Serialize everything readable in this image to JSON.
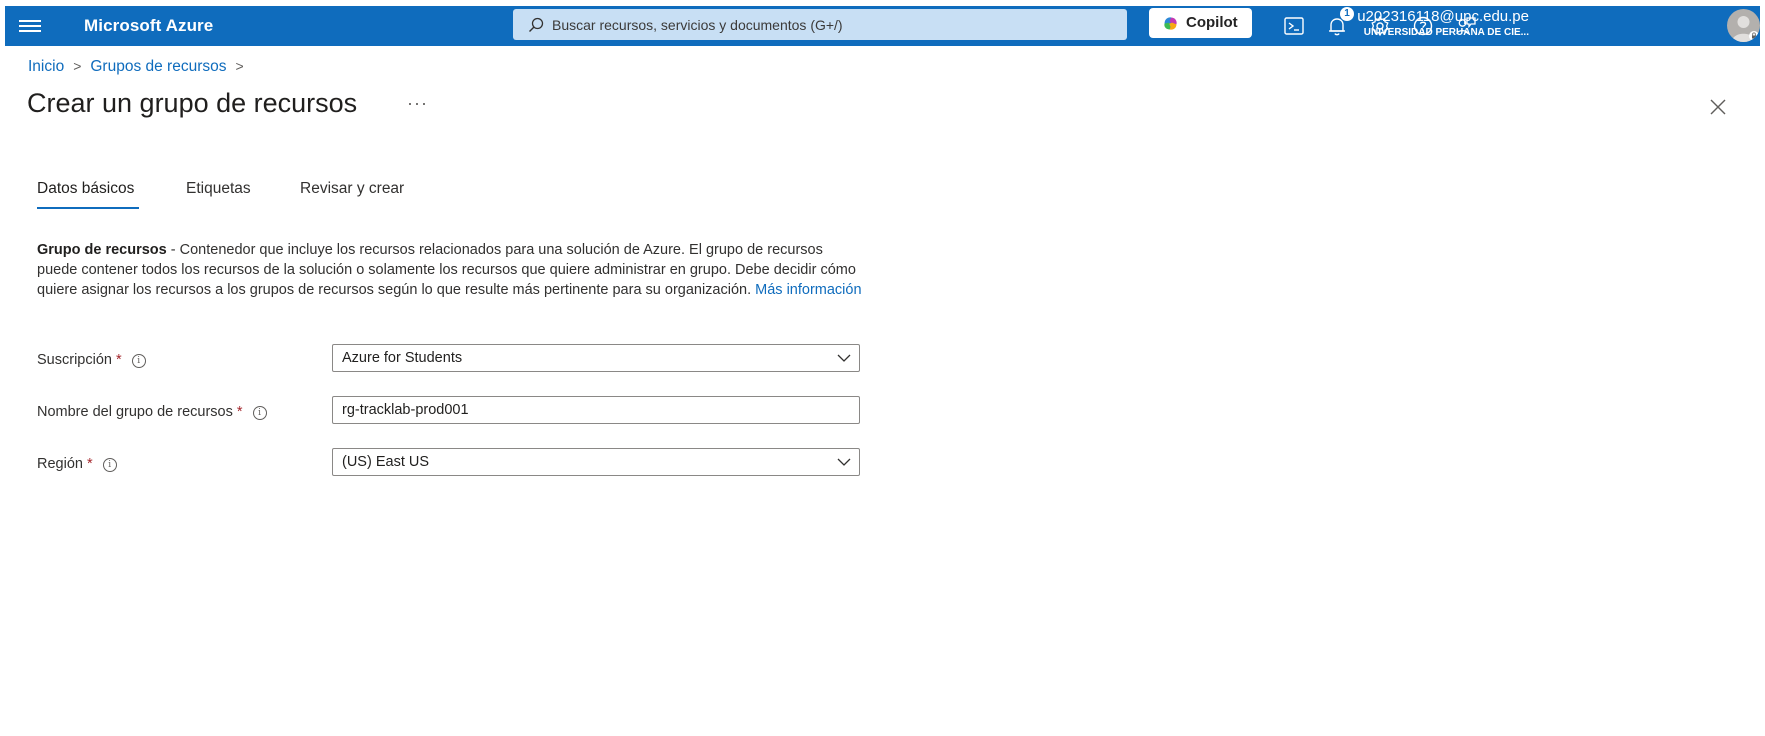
{
  "header": {
    "menu_icon": "hamburger-icon",
    "brand": "Microsoft Azure",
    "search_placeholder": "Buscar recursos, servicios y documentos (G+/)",
    "copilot_label": "Copilot",
    "notification_count": "1",
    "user_email": "u202316118@upc.edu.pe",
    "user_org": "UNIVERSIDAD PERUANA DE CIE...",
    "icons": [
      "cloud-shell-icon",
      "bell-icon",
      "gear-icon",
      "help-icon",
      "feedback-icon"
    ]
  },
  "breadcrumb": {
    "items": [
      "Inicio",
      "Grupos de recursos"
    ]
  },
  "page": {
    "title": "Crear un grupo de recursos",
    "more": "···"
  },
  "tabs": [
    {
      "label": "Datos básicos",
      "active": true
    },
    {
      "label": "Etiquetas",
      "active": false
    },
    {
      "label": "Revisar y crear",
      "active": false
    }
  ],
  "description": {
    "bold": "Grupo de recursos",
    "text": " - Contenedor que incluye los recursos relacionados para una solución de Azure. El grupo de recursos puede contener todos los recursos de la solución o solamente los recursos que quiere administrar en grupo. Debe decidir cómo quiere asignar los recursos a los grupos de recursos según lo que resulte más pertinente para su organización.",
    "link": "Más información"
  },
  "form": {
    "subscription": {
      "label": "Suscripción",
      "required": "*",
      "value": "Azure for Students"
    },
    "resource_group": {
      "label": "Nombre del grupo de recursos",
      "required": "*",
      "value": "rg-tracklab-prod001"
    },
    "region": {
      "label": "Región",
      "required": "*",
      "value": "(US) East US"
    },
    "info_glyph": "i"
  },
  "colors": {
    "accent": "#0f6cbd",
    "required": "#a4262c"
  }
}
